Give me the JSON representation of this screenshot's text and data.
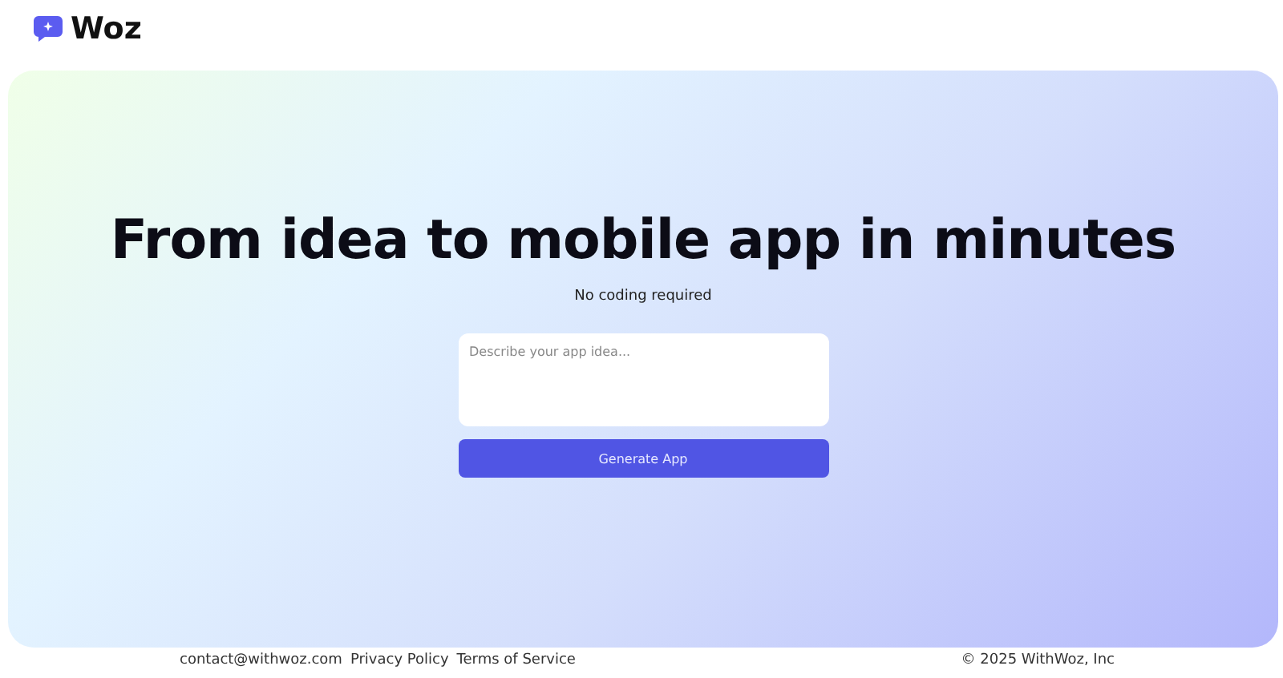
{
  "header": {
    "brand": "Woz"
  },
  "hero": {
    "title": "From idea to mobile app in minutes",
    "subtitle": "No coding required",
    "prompt": {
      "placeholder": "Describe your app idea..."
    },
    "button": "Generate App"
  },
  "footer": {
    "links": [
      "contact@withwoz.com",
      "Privacy Policy",
      "Terms of Service"
    ],
    "copyright": "© 2025 WithWoz, Inc"
  }
}
